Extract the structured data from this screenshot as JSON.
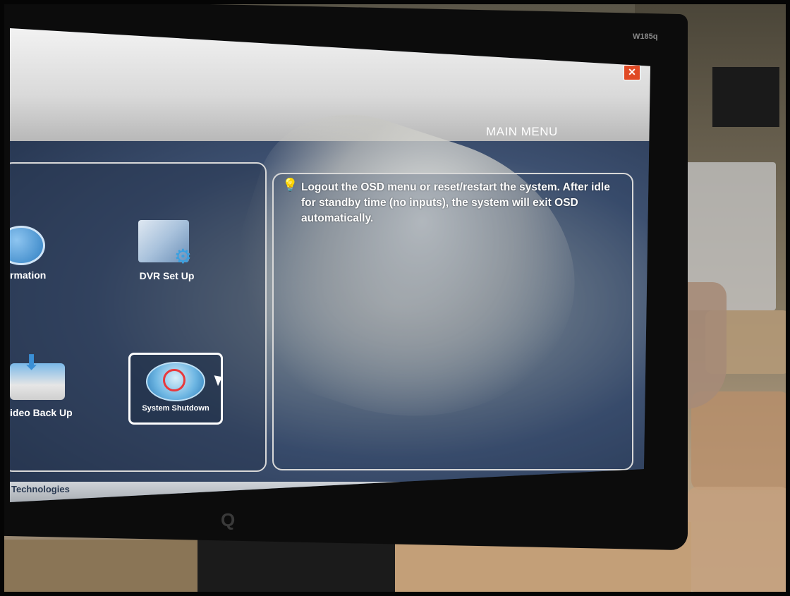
{
  "window": {
    "title": "MAIN MENU",
    "close_icon": "close-icon"
  },
  "menu": {
    "items": [
      {
        "label": "rmation",
        "icon": "information-icon"
      },
      {
        "label": "DVR Set Up",
        "icon": "dvr-setup-icon"
      },
      {
        "label": "ideo Back Up",
        "icon": "video-backup-icon"
      },
      {
        "label": "System Shutdown",
        "icon": "power-icon",
        "selected": true
      }
    ]
  },
  "hint": {
    "icon": "lightbulb-icon",
    "text": "Logout the OSD menu or reset/restart the system. After idle for standby time (no inputs), the system will exit OSD automatically."
  },
  "footer": {
    "text": "Technologies"
  },
  "monitor": {
    "model": "W185q",
    "brand_mark": "Q"
  },
  "colors": {
    "close_button": "#e04a25",
    "selection_border": "#ffffff",
    "hint_icon": "#f3c22d"
  }
}
